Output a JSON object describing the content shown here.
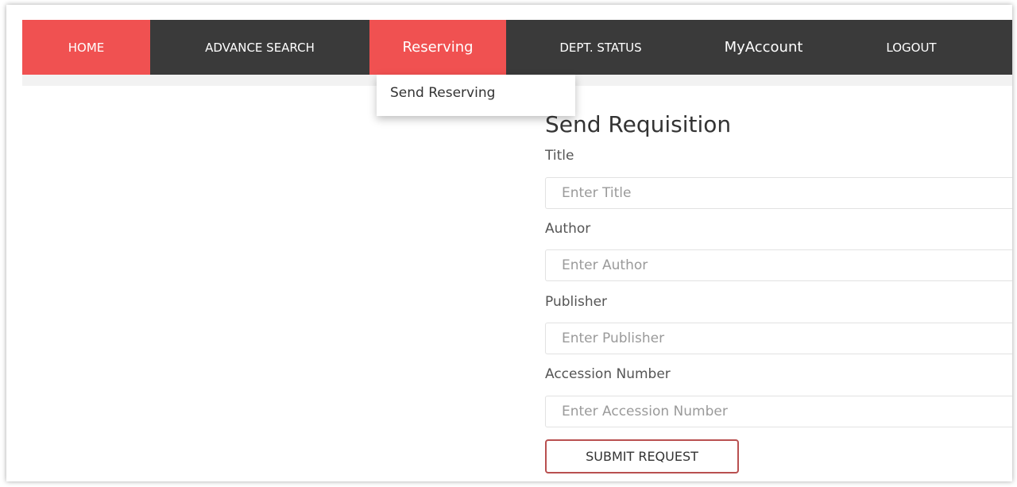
{
  "nav": {
    "items": [
      {
        "label": "HOME",
        "active": true
      },
      {
        "label": "ADVANCE SEARCH",
        "active": false
      },
      {
        "label": "Reserving",
        "active": true
      },
      {
        "label": "DEPT. STATUS",
        "active": false
      },
      {
        "label": "MyAccount",
        "active": false
      },
      {
        "label": "LOGOUT",
        "active": false
      }
    ],
    "dropdown": {
      "items": [
        {
          "label": "Send Reserving"
        }
      ]
    }
  },
  "form": {
    "title": "Send Requisition",
    "fields": [
      {
        "label": "Title",
        "placeholder": "Enter Title",
        "value": ""
      },
      {
        "label": "Author",
        "placeholder": "Enter Author",
        "value": ""
      },
      {
        "label": "Publisher",
        "placeholder": "Enter Publisher",
        "value": ""
      },
      {
        "label": "Accession Number",
        "placeholder": "Enter Accession Number",
        "value": ""
      }
    ],
    "submit_label": "SUBMIT REQUEST"
  },
  "colors": {
    "nav_background": "#3a3a3a",
    "nav_active": "#f05151",
    "submit_border": "#b95050"
  }
}
